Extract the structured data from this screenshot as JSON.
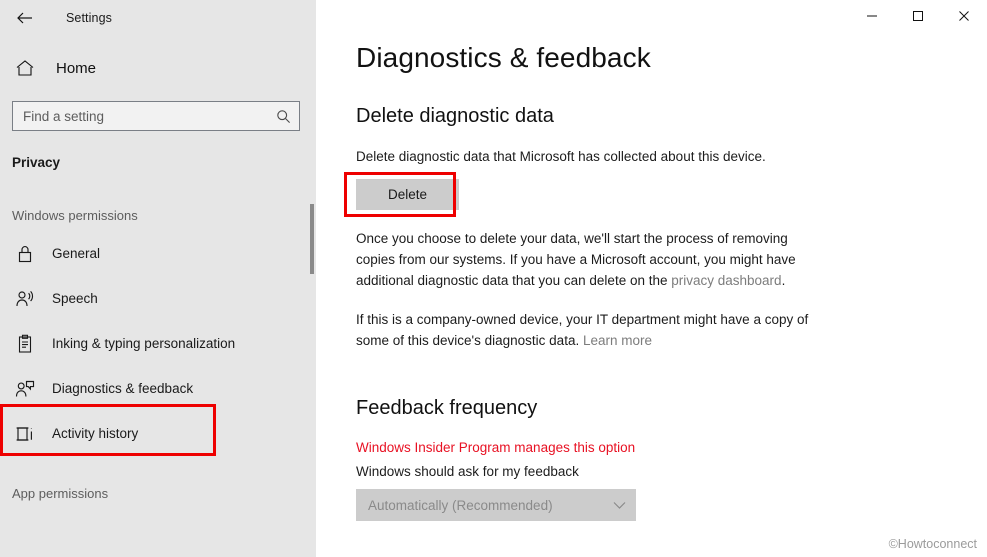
{
  "window": {
    "title": "Settings",
    "back_icon": "back-arrow-icon",
    "minimize_label": "─",
    "maximize_label": "□",
    "close_label": "✕"
  },
  "sidebar": {
    "home_label": "Home",
    "home_icon": "home-icon",
    "search": {
      "placeholder": "Find a setting",
      "value": "",
      "icon": "search-icon"
    },
    "category": "Privacy",
    "group_windows_permissions": "Windows permissions",
    "group_app_permissions": "App permissions",
    "items": [
      {
        "label": "General",
        "icon": "lock-icon",
        "selected": false
      },
      {
        "label": "Speech",
        "icon": "speech-person-icon",
        "selected": false
      },
      {
        "label": "Inking & typing personalization",
        "icon": "clipboard-pen-icon",
        "selected": false
      },
      {
        "label": "Diagnostics & feedback",
        "icon": "feedback-person-icon",
        "selected": true
      },
      {
        "label": "Activity history",
        "icon": "activity-history-icon",
        "selected": false
      }
    ]
  },
  "main": {
    "page_title": "Diagnostics & feedback",
    "delete_section": {
      "heading": "Delete diagnostic data",
      "description": "Delete diagnostic data that Microsoft has collected about this device.",
      "button_label": "Delete",
      "paragraph1_part1": "Once you choose to delete your data, we'll start the process of removing copies from our systems. If you have a Microsoft account, you might have additional diagnostic data that you can delete on the ",
      "paragraph1_link": "privacy dashboard",
      "paragraph1_part2": ".",
      "paragraph2_part1": "If this is a company-owned device, your IT department might have a copy of some of this device's diagnostic data. ",
      "paragraph2_link": "Learn more"
    },
    "feedback_section": {
      "heading": "Feedback frequency",
      "managed_note": "Windows Insider Program manages this option",
      "label": "Windows should ask for my feedback",
      "dropdown_value": "Automatically (Recommended)",
      "dropdown_icon": "chevron-down-icon",
      "dropdown_disabled": true
    }
  },
  "watermark": "©Howtoconnect",
  "colors": {
    "highlight_red": "#ee0000",
    "alert_red": "#e81123",
    "sidebar_bg": "#e6e6e6",
    "button_gray": "#cccccc"
  }
}
